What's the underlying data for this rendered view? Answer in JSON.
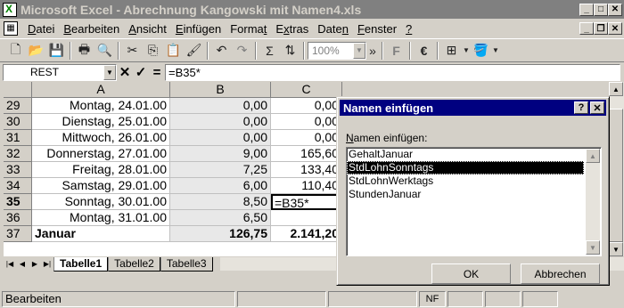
{
  "window": {
    "title": "Microsoft Excel - Abrechnung Kangowski mit Namen4.xls"
  },
  "menu": {
    "items": [
      {
        "u": "D",
        "rest": "atei"
      },
      {
        "u": "B",
        "rest": "earbeiten"
      },
      {
        "u": "A",
        "rest": "nsicht"
      },
      {
        "u": "E",
        "rest": "infügen"
      },
      {
        "pre": "Forma",
        "u": "t",
        "rest": ""
      },
      {
        "pre": "E",
        "u": "x",
        "rest": "tras"
      },
      {
        "pre": "Date",
        "u": "n",
        "rest": ""
      },
      {
        "u": "F",
        "rest": "enster"
      },
      {
        "u": "?",
        "rest": ""
      }
    ]
  },
  "toolbar": {
    "zoom": "100%",
    "sum_label": "Σ",
    "euro": "€"
  },
  "formula_bar": {
    "name_box": "REST",
    "cancel": "✕",
    "enter": "✓",
    "equals": "=",
    "formula": "=B35*"
  },
  "columns": [
    "A",
    "B",
    "C"
  ],
  "rows": [
    {
      "num": "29",
      "a": "Montag, 24.01.00",
      "b": "0,00",
      "c": "0,00"
    },
    {
      "num": "30",
      "a": "Dienstag, 25.01.00",
      "b": "0,00",
      "c": "0,00"
    },
    {
      "num": "31",
      "a": "Mittwoch, 26.01.00",
      "b": "0,00",
      "c": "0,00"
    },
    {
      "num": "32",
      "a": "Donnerstag, 27.01.00",
      "b": "9,00",
      "c": "165,60"
    },
    {
      "num": "33",
      "a": "Freitag, 28.01.00",
      "b": "7,25",
      "c": "133,40"
    },
    {
      "num": "34",
      "a": "Samstag, 29.01.00",
      "b": "6,00",
      "c": "110,40"
    },
    {
      "num": "35",
      "a": "Sonntag, 30.01.00",
      "b": "8,50",
      "c": "=B35*"
    },
    {
      "num": "36",
      "a": "Montag, 31.01.00",
      "b": "6,50",
      "c": ""
    },
    {
      "num": "37",
      "a": "Januar",
      "b": "126,75",
      "c": "2.141,20"
    }
  ],
  "sheets": [
    "Tabelle1",
    "Tabelle2",
    "Tabelle3"
  ],
  "status": {
    "mode": "Bearbeiten",
    "nf": "NF"
  },
  "dialog": {
    "title": "Namen einfügen",
    "help": "?",
    "close": "✕",
    "label_u": "N",
    "label_rest": "amen einfügen:",
    "names": [
      "GehaltJanuar",
      "StdLohnSonntags",
      "StdLohnWerktags",
      "StundenJanuar"
    ],
    "selected_index": 1,
    "ok": "OK",
    "cancel": "Abbrechen"
  }
}
